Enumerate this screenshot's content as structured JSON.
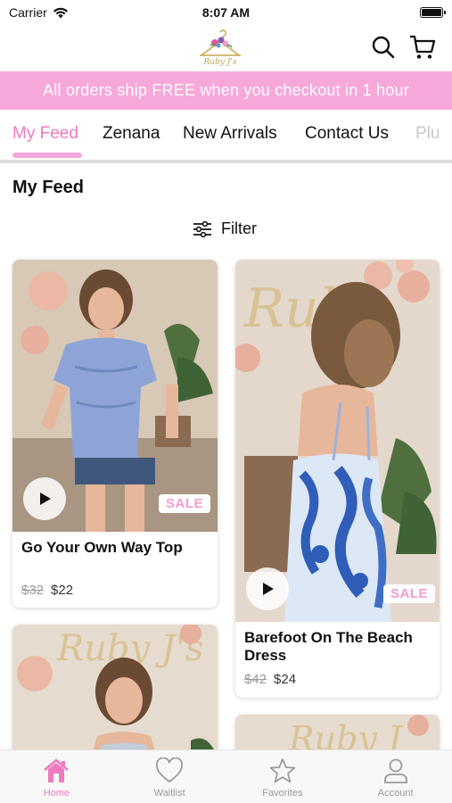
{
  "status": {
    "carrier": "Carrier",
    "time": "8:07 AM"
  },
  "header": {
    "logo_text": "Ruby J's"
  },
  "promo": {
    "text": "All orders ship FREE when you checkout in 1 hour"
  },
  "tabs": [
    {
      "label": "My Feed"
    },
    {
      "label": "Zenana"
    },
    {
      "label": "New Arrivals"
    },
    {
      "label": "Contact Us"
    },
    {
      "label": "Plu"
    }
  ],
  "section": {
    "title": "My Feed"
  },
  "filter": {
    "label": "Filter"
  },
  "products": [
    {
      "title": "Go Your Own Way Top",
      "badge": "SALE",
      "old_price": "$32",
      "price": "$22"
    },
    {
      "title_line1": "Barefoot On The Beach",
      "title_line2": "Dress",
      "badge": "SALE",
      "old_price": "$42",
      "price": "$24"
    }
  ],
  "bottom_nav": [
    {
      "label": "Home"
    },
    {
      "label": "Waitlist"
    },
    {
      "label": "Favorites"
    },
    {
      "label": "Account"
    }
  ],
  "colors": {
    "accent": "#f07ac0",
    "promo_bg": "#f7a8da"
  }
}
